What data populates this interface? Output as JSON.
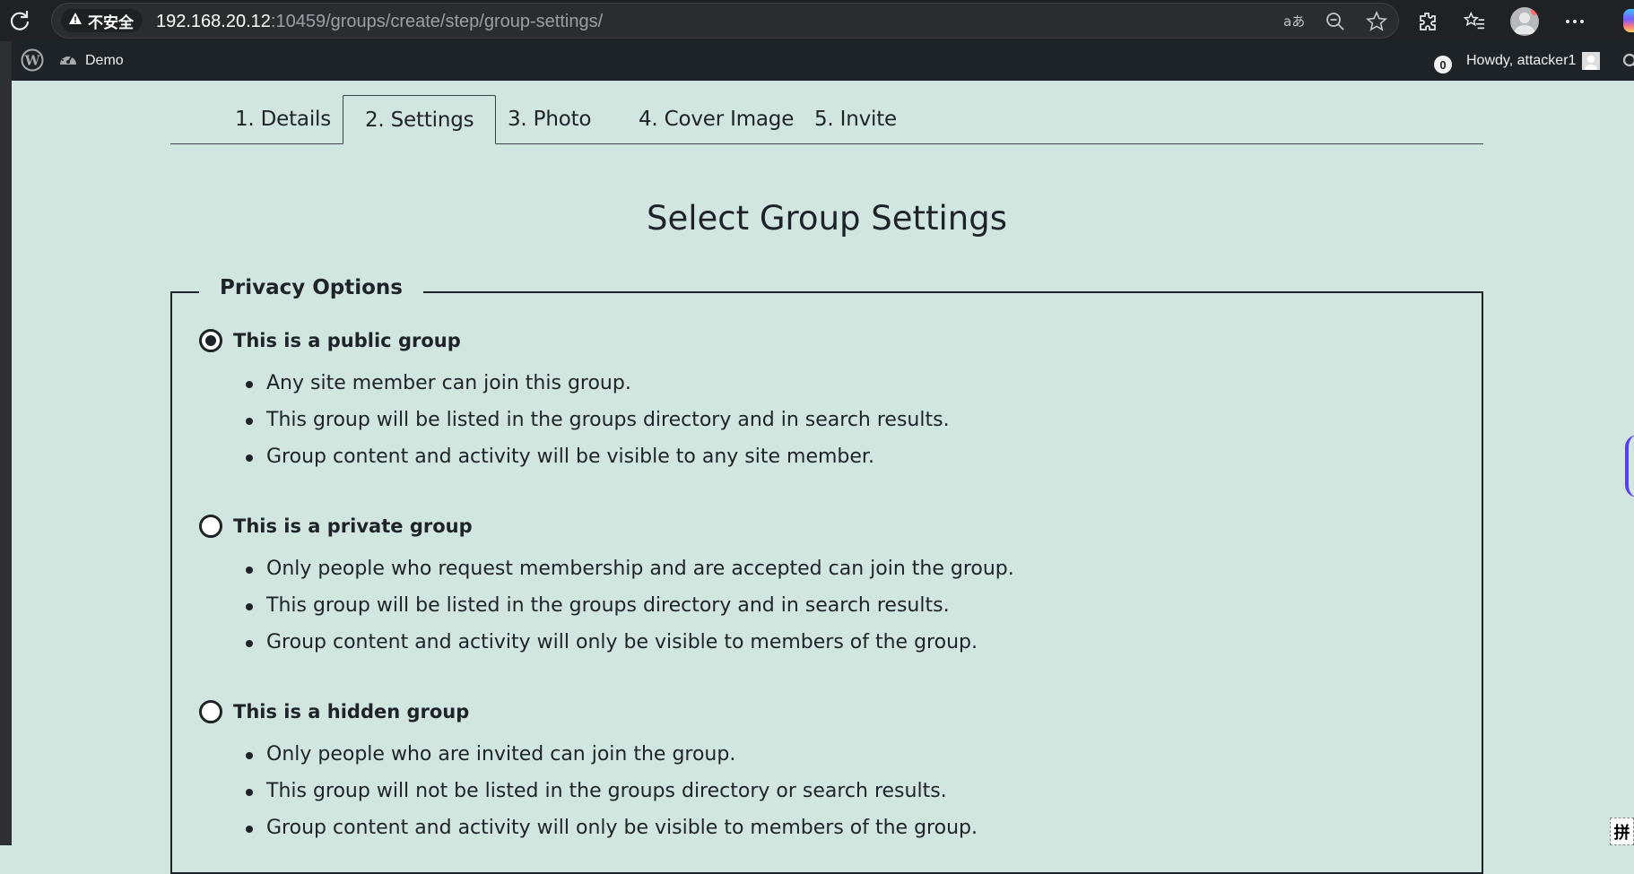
{
  "browser": {
    "security_label": "不安全",
    "url_host": "192.168.20.12",
    "url_path": ":10459/groups/create/step/group-settings/"
  },
  "adminbar": {
    "site_name": "Demo",
    "notification_count": "0",
    "howdy": "Howdy, attacker1"
  },
  "tabs": [
    {
      "label": "1. Details"
    },
    {
      "label": "2. Settings",
      "active": true
    },
    {
      "label": "3. Photo"
    },
    {
      "label": "4. Cover Image"
    },
    {
      "label": "5. Invite"
    }
  ],
  "page": {
    "title": "Select Group Settings",
    "privacy_legend": "Privacy Options",
    "options": [
      {
        "label": "This is a public group",
        "checked": true,
        "points": [
          "Any site member can join this group.",
          "This group will be listed in the groups directory and in search results.",
          "Group content and activity will be visible to any site member."
        ]
      },
      {
        "label": "This is a private group",
        "checked": false,
        "points": [
          "Only people who request membership and are accepted can join the group.",
          "This group will be listed in the groups directory and in search results.",
          "Group content and activity will only be visible to members of the group."
        ]
      },
      {
        "label": "This is a hidden group",
        "checked": false,
        "points": [
          "Only people who are invited can join the group.",
          "This group will not be listed in the groups directory or search results.",
          "Group content and activity will only be visible to members of the group."
        ]
      }
    ]
  },
  "ime": {
    "label": "拼"
  }
}
